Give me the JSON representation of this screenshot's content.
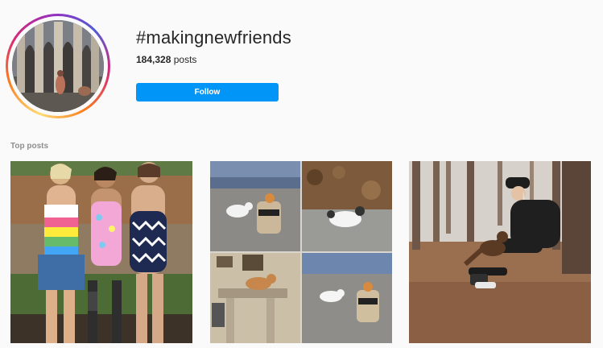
{
  "hashtag": {
    "title": "#makingnewfriends",
    "post_count": "184,328",
    "post_count_suffix": "posts",
    "follow_label": "Follow"
  },
  "top_posts": {
    "label": "Top posts",
    "items": [
      {
        "description": "three women in swimsuits posing outdoors"
      },
      {
        "description": "collage of cats meeting in a yard"
      },
      {
        "description": "woman in black beanie petting a dog in forest"
      }
    ]
  },
  "colors": {
    "accent": "#0095f6",
    "background": "#fafafa",
    "muted_text": "#8e8e8e"
  }
}
